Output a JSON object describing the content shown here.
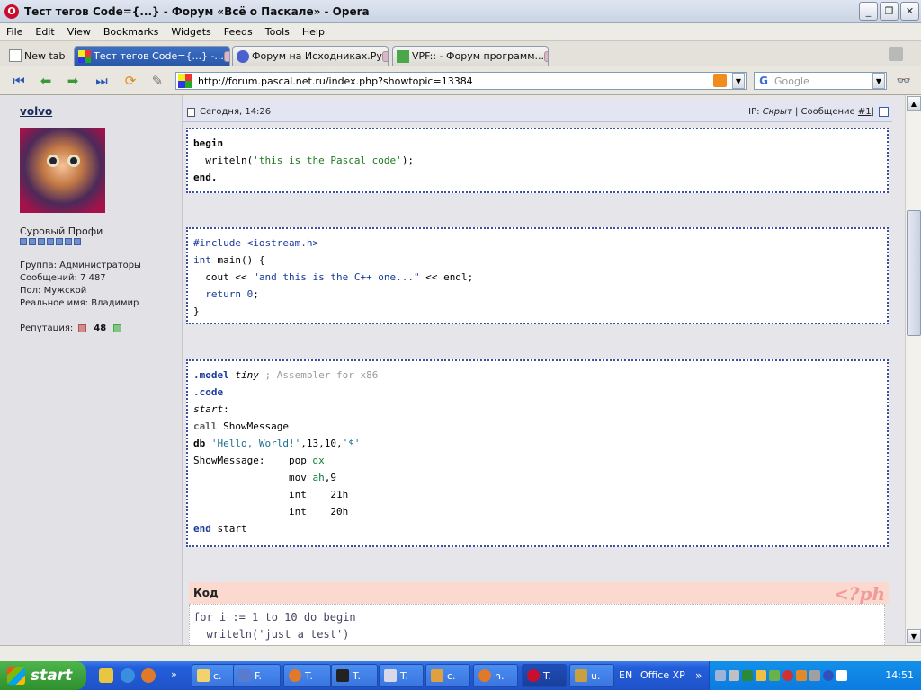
{
  "window": {
    "title": "Тест тегов Code={...} - Форум «Всё о Паскале» - Opera"
  },
  "menu": [
    "File",
    "Edit",
    "View",
    "Bookmarks",
    "Widgets",
    "Feeds",
    "Tools",
    "Help"
  ],
  "tabs": {
    "new_tab": "New tab",
    "items": [
      {
        "label": "Тест тегов Code={...} -..."
      },
      {
        "label": "Форум на Исходниках.Ру"
      },
      {
        "label": "VPF:: - Форум программ..."
      }
    ]
  },
  "address": {
    "url": "http://forum.pascal.net.ru/index.php?showtopic=13384",
    "search_placeholder": "Google"
  },
  "user": {
    "name": "volvo",
    "rank": "Суровый Профи",
    "group": "Группа: Администраторы",
    "posts": "Сообщений: 7 487",
    "gender": "Пол: Мужской",
    "realname": "Реальное имя: Владимир",
    "reputation_label": "Репутация:",
    "reputation_value": "48"
  },
  "post": {
    "date": "Сегодня, 14:26",
    "ip_label": "IP:",
    "ip_value": "Скрыт",
    "sep": "|",
    "msg_label": "Сообщение",
    "msg_num": "#1"
  },
  "code_pascal": {
    "l1": "begin",
    "l2_a": "  writeln(",
    "l2_s": "'this is the Pascal code'",
    "l2_b": ");",
    "l3": "end."
  },
  "code_cpp": {
    "l1": "#include <iostream.h>",
    "l2_k": "int",
    "l2_b": " main() {",
    "l3_a": "  cout << ",
    "l3_s": "\"and this is the C++ one...\"",
    "l3_b": " << endl;",
    "l4_k": "  return",
    "l4_n": " 0",
    "l4_b": ";",
    "l5": "}"
  },
  "code_asm": {
    "l1_k": ".model",
    "l1_i": " tiny",
    "l1_c": " ; Assembler for x86",
    "l2": ".code",
    "l3": "start",
    "l3_b": ":",
    "l4_k": "call",
    "l4_b": " ShowMessage",
    "l5_k": "db",
    "l5_s": " 'Hello, World!'",
    "l5_b": ",13,10,",
    "l5_s2": "'$'",
    "l6_a": "ShowMessage:    pop ",
    "l6_r": "dx",
    "l7_a": "                mov ",
    "l7_r": "ah",
    "l7_b": ",9",
    "l8": "                int    21h",
    "l9": "                int    20h",
    "l10_k": "end",
    "l10_b": " start"
  },
  "code_block": {
    "title": "Код",
    "badge": "<?ph",
    "l1": "for i := 1 to 10 do begin",
    "l2": "  writeln('just a test')"
  },
  "taskbar": {
    "start": "start",
    "tasks": [
      "c.",
      "F.",
      "T.",
      "T.",
      "T.",
      "c.",
      "h.",
      "T.",
      "u."
    ],
    "lang": "EN",
    "office": "Office XP",
    "clock": "14:51"
  },
  "colors": {
    "accent": "#245edb",
    "code_border": "#3a4fa0",
    "code_title_bg": "#fbd9cf"
  }
}
